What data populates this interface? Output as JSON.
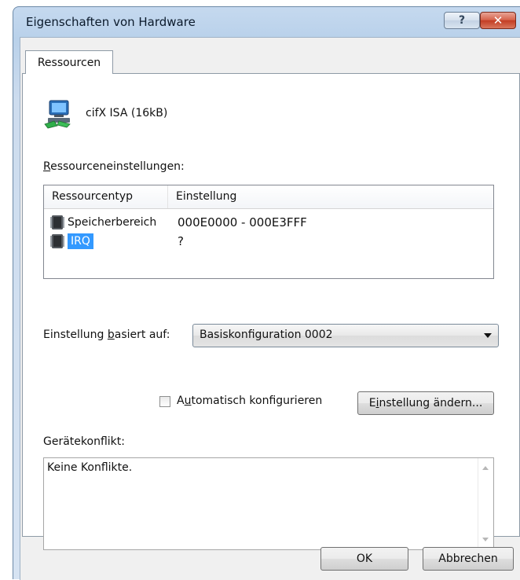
{
  "window": {
    "title": "Eigenschaften von Hardware",
    "help_label": "?",
    "close_label": "✕"
  },
  "tabs": [
    {
      "label": "Ressourcen",
      "selected": true
    }
  ],
  "device": {
    "icon": "network-card-icon",
    "name": "cifX ISA (16kB)"
  },
  "resources": {
    "label_first": "R",
    "label_rest": "essourceneinstellungen:",
    "columns": [
      "Ressourcentyp",
      "Einstellung"
    ],
    "rows": [
      {
        "type": "Speicherbereich",
        "setting": "000E0000 - 000E3FFF",
        "icon": "memory-chip-icon",
        "selected": false
      },
      {
        "type": "IRQ",
        "setting": "?",
        "icon": "memory-chip-icon",
        "selected": true
      }
    ]
  },
  "based_on": {
    "label_pre": "Einstellung ",
    "label_u": "b",
    "label_post": "asiert auf:",
    "value": "Basiskonfiguration 0002"
  },
  "auto_config": {
    "label_pre": "A",
    "label_u": "u",
    "label_post": "tomatisch konfigurieren",
    "checked": false
  },
  "change_button": {
    "label_pre": "E",
    "label_u": "i",
    "label_post": "nstellung ändern..."
  },
  "conflict": {
    "label": "Gerätekonflikt:",
    "text": "Keine Konflikte."
  },
  "footer": {
    "ok_label": "OK",
    "cancel_label": "Abbrechen"
  },
  "colors": {
    "selection": "#3399ff",
    "title_bar": "#b9d1ea",
    "close_button": "#c23c22"
  }
}
